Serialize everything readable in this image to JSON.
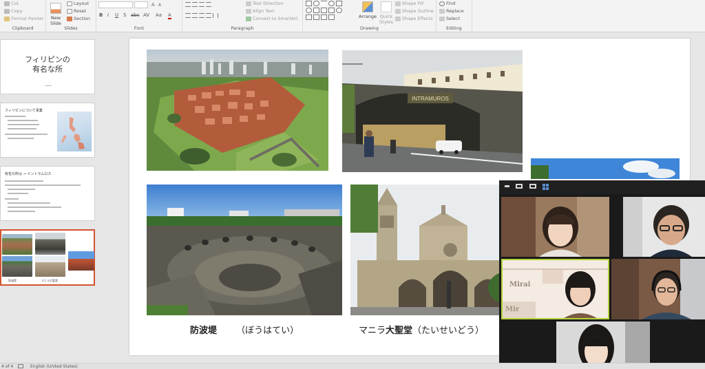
{
  "ribbon": {
    "clipboard": {
      "label": "Clipboard",
      "cut": "Cut",
      "copy": "Copy",
      "format_painter": "Format Painter"
    },
    "slides": {
      "label": "Slides",
      "new_slide": "New",
      "new_slide_2": "Slide",
      "layout": "Layout",
      "reset": "Reset",
      "section": "Section"
    },
    "font": {
      "label": "Font",
      "bold": "B",
      "italic": "I",
      "underline": "U",
      "strike": "S",
      "shadow": "abc",
      "spacing": "AV",
      "case": "Aa",
      "color": "A"
    },
    "paragraph": {
      "label": "Paragraph",
      "text_direction": "Text Direction",
      "align_text": "Align Text",
      "smartart": "Convert to SmartArt"
    },
    "drawing": {
      "label": "Drawing",
      "arrange": "Arrange",
      "quick_styles": "Quick",
      "quick_styles_2": "Styles",
      "shape_fill": "Shape Fill",
      "shape_outline": "Shape Outline",
      "shape_effects": "Shape Effects"
    },
    "editing": {
      "label": "Editing",
      "find": "Find",
      "replace": "Replace",
      "select": "Select"
    }
  },
  "thumbnails": [
    {
      "title_line1": "フィリピンの",
      "title_line2": "有名な所"
    },
    {
      "heading": "フィリピンについて事業"
    },
    {
      "heading": "有名な所は → イントラムロス"
    },
    {
      "captions": [
        "防波堤",
        "マニラ大聖堂"
      ]
    }
  ],
  "slide": {
    "caption_left": "防波堤",
    "caption_left_reading": "（ぼうはてい）",
    "caption_right_prefix": "マニラ",
    "caption_right_bold": "大聖堂",
    "caption_right_reading": "（たいせいどう）",
    "sign_text": "INTRAMUROS"
  },
  "status": {
    "slide_counter": "4 of 4",
    "language": "English (United States)"
  },
  "zoom": {
    "sign_word_1": "Mirai",
    "sign_word_2": "Mir"
  },
  "colors": {
    "accent": "#d35230",
    "speaking": "#b6d43a",
    "zoom_grid": "#5b8fd6"
  }
}
